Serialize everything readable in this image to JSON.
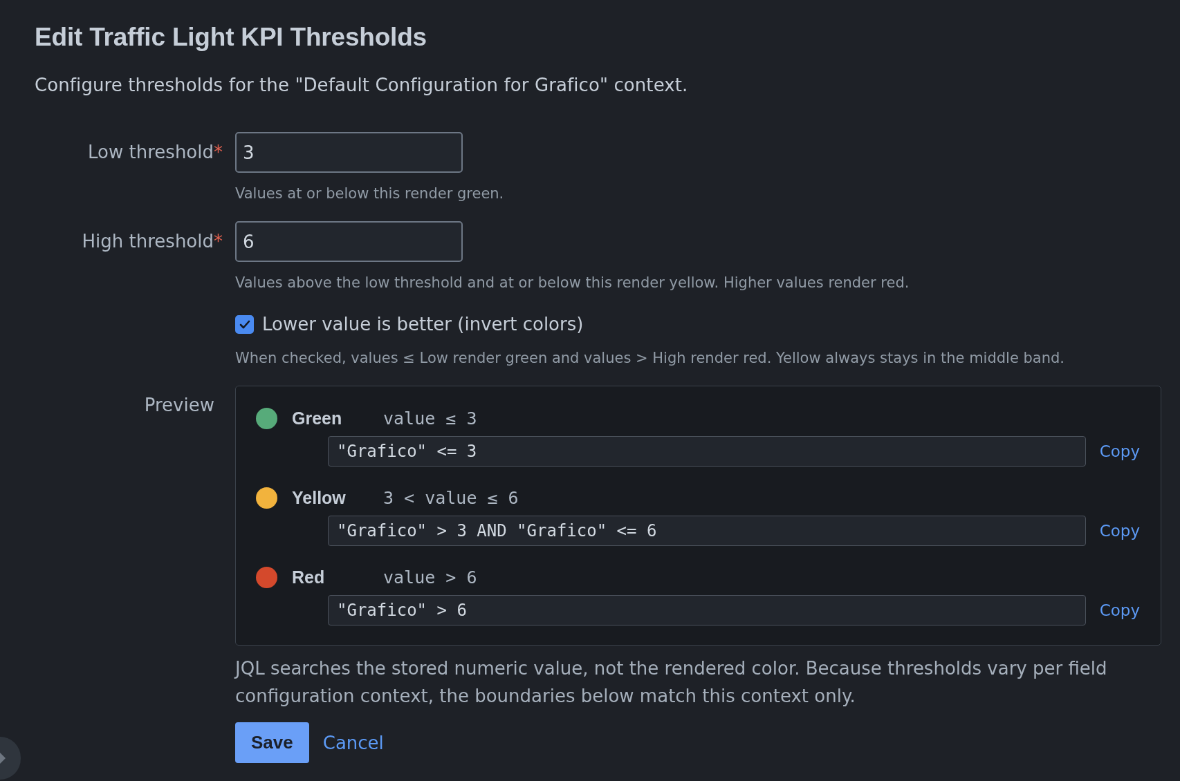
{
  "title": "Edit Traffic Light KPI Thresholds",
  "description": "Configure thresholds for the \"Default Configuration for Grafico\" context.",
  "fields": [
    {
      "label": "Low threshold",
      "required_mark": "*",
      "value": "3",
      "hint": "Values at or below this render green."
    },
    {
      "label": "High threshold",
      "required_mark": "*",
      "value": "6",
      "hint": "Values above the low threshold and at or below this render yellow. Higher values render red."
    }
  ],
  "invert_option": {
    "label": "Lower value is better (invert colors)",
    "checked": true,
    "hint": "When checked, values ≤ Low render green and values > High render red. Yellow always stays in the middle band."
  },
  "preview": {
    "label": "Preview",
    "rows": [
      {
        "name": "Green",
        "color": "#57ab7a",
        "condition": "value ≤ 3",
        "query": "\"Grafico\" <= 3",
        "action": "Copy"
      },
      {
        "name": "Yellow",
        "color": "#f2b33d",
        "condition": "3 < value ≤ 6",
        "query": "\"Grafico\" > 3 AND \"Grafico\" <= 6",
        "action": "Copy"
      },
      {
        "name": "Red",
        "color": "#d4492c",
        "condition": "value > 6",
        "query": "\"Grafico\" > 6",
        "action": "Copy"
      }
    ]
  },
  "note": "JQL searches the stored numeric value, not the rendered color. Because thresholds vary per field configuration context, the boundaries below match this context only.",
  "buttons": [
    {
      "label": "Save",
      "kind": "primary"
    },
    {
      "label": "Cancel",
      "kind": "link"
    }
  ]
}
